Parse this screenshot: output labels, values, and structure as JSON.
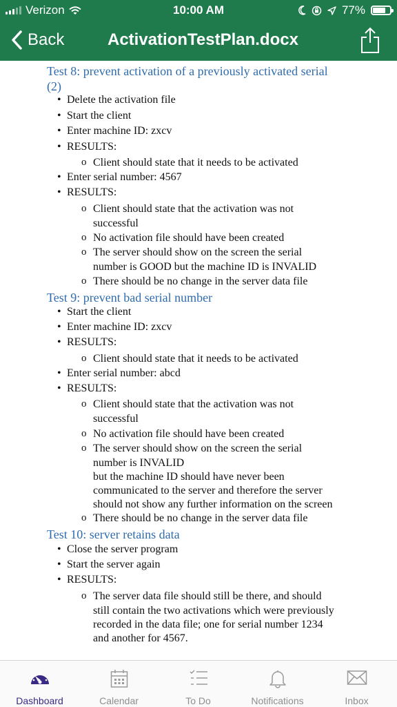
{
  "status": {
    "carrier": "Verizon",
    "time": "10:00 AM",
    "battery": "77%",
    "battery_level": 0.77
  },
  "nav": {
    "back_label": "Back",
    "title": "ActivationTestPlan.docx"
  },
  "document": {
    "test8": {
      "heading_line1": "Test 8: prevent activation of a previously activated serial",
      "heading_line2": "(2)",
      "b1": "Delete the activation file",
      "b2": "Start the client",
      "b3": "Enter machine ID: zxcv",
      "b4": "RESULTS:",
      "s1": "Client should state that it needs to be activated",
      "b5": "Enter serial number: 4567",
      "b6": "RESULTS:",
      "s2a": "Client should state that the activation was not",
      "s2b": "successful",
      "s3": "No activation file should have been created",
      "s4a": "The server should show on the screen the serial",
      "s4b": "number is GOOD but the machine ID is INVALID",
      "s5": "There should be no change in the server data file"
    },
    "test9": {
      "heading": "Test 9: prevent bad serial number",
      "b1": "Start the client",
      "b2": "Enter machine ID: zxcv",
      "b3": "RESULTS:",
      "s1": "Client should state that it needs to be activated",
      "b4": "Enter serial number: abcd",
      "b5": "RESULTS:",
      "s2a": "Client should state that the activation was not",
      "s2b": "successful",
      "s3": "No activation file should have been created",
      "s4a": "The server should show on the screen the serial",
      "s4b": "number is INVALID",
      "s4c": "but the machine ID should have never been",
      "s4d": "communicated to the server and therefore the server",
      "s4e": "should not show any further information on the screen",
      "s5": "There should be no change in the server data file"
    },
    "test10": {
      "heading": "Test 10: server retains data",
      "b1": "Close the server program",
      "b2": "Start the server again",
      "b3": "RESULTS:",
      "s1a": "The server data file should still be there, and should",
      "s1b": "still contain the two activations which were previously",
      "s1c": "recorded in the data file; one for serial number 1234",
      "s1d": "and another for 4567."
    }
  },
  "tabs": [
    {
      "label": "Dashboard",
      "icon": "dashboard-gauge-icon"
    },
    {
      "label": "Calendar",
      "icon": "calendar-icon"
    },
    {
      "label": "To Do",
      "icon": "todo-list-icon"
    },
    {
      "label": "Notifications",
      "icon": "bell-icon"
    },
    {
      "label": "Inbox",
      "icon": "envelope-icon"
    }
  ],
  "colors": {
    "header_green": "#1f7a4c",
    "heading_blue": "#2f6cae",
    "active_tab": "#3b2a85"
  }
}
